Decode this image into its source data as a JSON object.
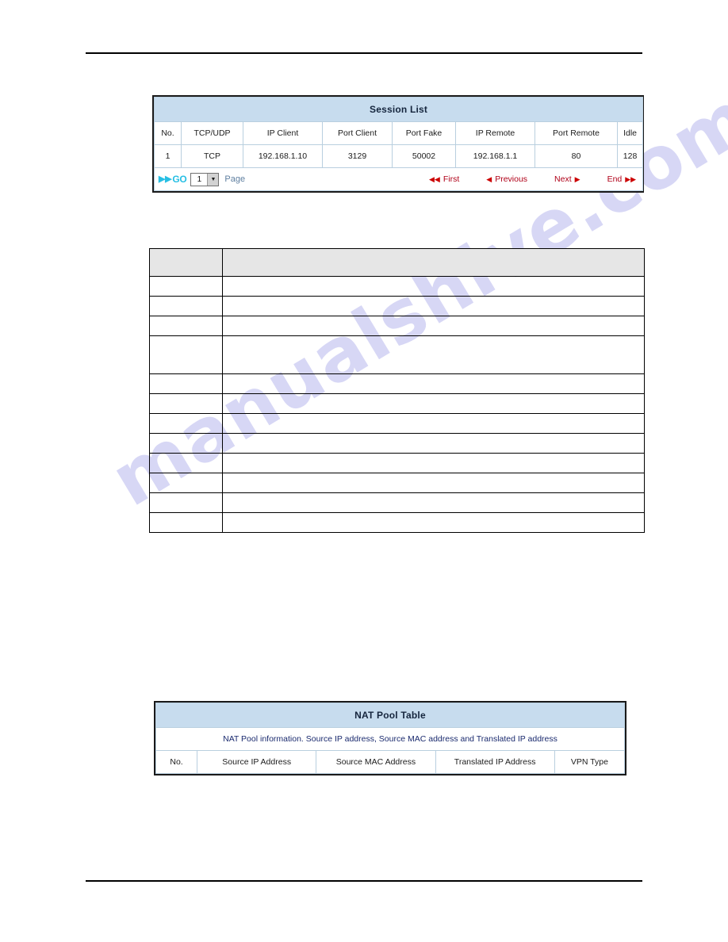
{
  "watermark": {
    "text": "manualshive.com"
  },
  "session_list": {
    "title": "Session List",
    "columns": [
      "No.",
      "TCP/UDP",
      "IP Client",
      "Port Client",
      "Port Fake",
      "IP Remote",
      "Port Remote",
      "Idle"
    ],
    "rows": [
      [
        "1",
        "TCP",
        "192.168.1.10",
        "3129",
        "50002",
        "192.168.1.1",
        "80",
        "128"
      ]
    ],
    "pager": {
      "go_label": "GO",
      "go_icon": "double-arrow-right-icon",
      "page_value": "1",
      "page_options": [
        "1"
      ],
      "page_label": "Page",
      "first_label": "First",
      "first_icon": "skip-to-start-icon",
      "previous_label": "Previous",
      "previous_icon": "triangle-left-icon",
      "next_label": "Next",
      "next_icon": "triangle-right-icon",
      "end_label": "End",
      "end_icon": "skip-to-end-icon"
    }
  },
  "spec_table": {
    "header": [
      "",
      ""
    ],
    "rows": [
      [
        "",
        ""
      ],
      [
        "",
        ""
      ],
      [
        "",
        ""
      ],
      [
        "",
        ""
      ],
      [
        "",
        ""
      ],
      [
        "",
        ""
      ],
      [
        "",
        ""
      ],
      [
        "",
        ""
      ],
      [
        "",
        ""
      ],
      [
        "",
        ""
      ],
      [
        "",
        ""
      ],
      [
        "",
        ""
      ]
    ]
  },
  "nat_pool_table": {
    "title": "NAT Pool Table",
    "description": "NAT Pool information. Source IP address, Source MAC address and Translated IP address",
    "columns": [
      "No.",
      "Source IP Address",
      "Source MAC Address",
      "Translated IP Address",
      "VPN Type"
    ]
  },
  "colors": {
    "title_bar": "#c7dcee",
    "grid_line": "#b9cfdf",
    "outer_border": "#1a1a1a",
    "go_accent": "#27bfe4",
    "nav_accent": "#b00018",
    "description_text": "#1a2a6e",
    "spec_header_fill": "#e6e6e6",
    "watermark": "#c9c9f2"
  }
}
